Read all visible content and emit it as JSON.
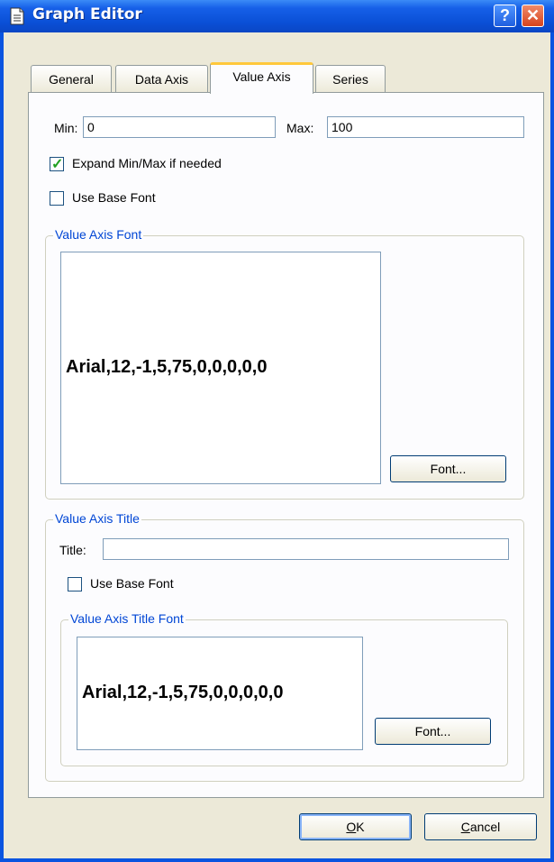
{
  "window": {
    "title": "Graph Editor"
  },
  "tabs": [
    {
      "label": "General"
    },
    {
      "label": "Data Axis"
    },
    {
      "label": "Value Axis"
    },
    {
      "label": "Series"
    }
  ],
  "active_tab": "Value Axis",
  "range": {
    "min_label": "Min:",
    "min_value": "0",
    "max_label": "Max:",
    "max_value": "100"
  },
  "expand_checkbox": {
    "label": "Expand Min/Max if needed",
    "checked": true
  },
  "base_font_checkbox": {
    "label": "Use Base Font",
    "checked": false
  },
  "value_axis_font": {
    "legend": "Value Axis Font",
    "preview": "Arial,12,-1,5,75,0,0,0,0,0",
    "button": "Font..."
  },
  "value_axis_title": {
    "legend": "Value Axis Title",
    "title_label": "Title:",
    "title_value": "",
    "base_font_label": "Use Base Font",
    "base_font_checked": false,
    "font_group": {
      "legend": "Value Axis Title Font",
      "preview": "Arial,12,-1,5,75,0,0,0,0,0",
      "button": "Font..."
    }
  },
  "footer": {
    "ok_mnemonic": "O",
    "ok_rest": "K",
    "cancel_mnemonic": "C",
    "cancel_rest": "ancel"
  },
  "icons": [
    "document-icon",
    "help-icon",
    "close-icon",
    "check-icon"
  ],
  "colors": {
    "title_bar": "#0a54e0",
    "group_legend": "#0046d5",
    "active_tab_accent": "#ffc83c"
  }
}
